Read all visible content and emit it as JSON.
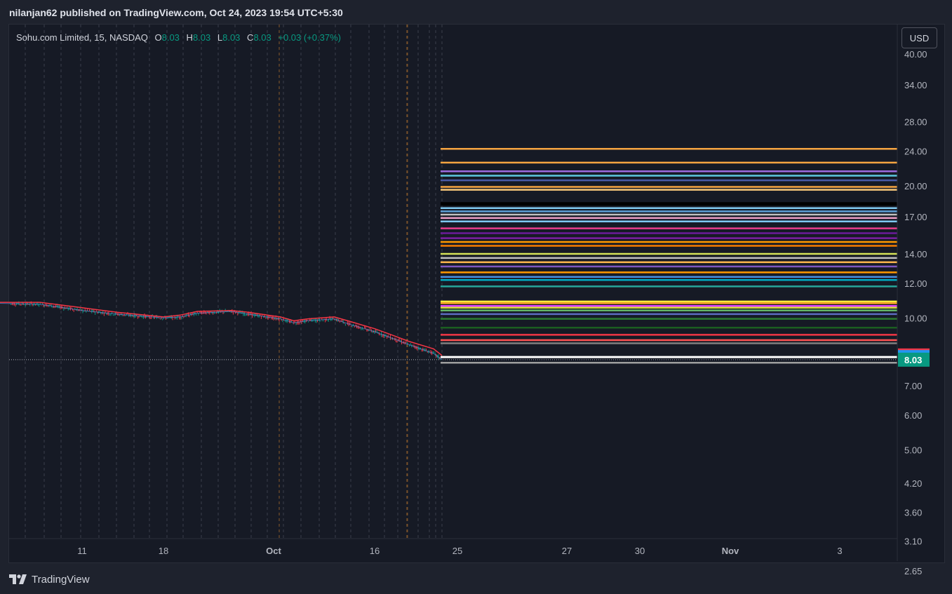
{
  "header": {
    "publish_text": "nilanjan62 published on TradingView.com, Oct 24, 2023 19:54 UTC+5:30"
  },
  "legend": {
    "symbol": "Sohu.com Limited, 15, NASDAQ",
    "open_label": "O",
    "open": "8.03",
    "high_label": "H",
    "high": "8.03",
    "low_label": "L",
    "low": "8.03",
    "close_label": "C",
    "close": "8.03",
    "change": "+0.03 (+0.37%)"
  },
  "currency_button": "USD",
  "footer": {
    "brand": "TradingView",
    "logo_icon": "tradingview-logo-icon"
  },
  "colors": {
    "background": "#161a25",
    "candle_up": "#089981",
    "candle_down": "#f23645",
    "ma_line": "#f23645",
    "price_dotted": "#b2b5be"
  },
  "chart_data": {
    "type": "line",
    "y_scale": "log",
    "ylim": [
      2.6,
      41
    ],
    "y_ticks": [
      "40.00",
      "34.00",
      "28.00",
      "24.00",
      "20.00",
      "17.00",
      "14.00",
      "12.00",
      "10.00",
      "7.00",
      "6.00",
      "5.00",
      "4.20",
      "3.60",
      "3.10",
      "2.65"
    ],
    "x_ticks": [
      "11",
      "18",
      "Oct",
      "16",
      "25",
      "27",
      "30",
      "Nov",
      "3"
    ],
    "series": [
      {
        "name": "",
        "x": [
          "Sep 5",
          "Sep 8",
          "Sep 11",
          "Sep 14",
          "Sep 18",
          "Sep 20",
          "Sep 22",
          "Sep 26",
          "Sep 28",
          "Oct 2",
          "Oct 4",
          "Oct 6",
          "Oct 10",
          "Oct 12",
          "Oct 16",
          "Oct 18",
          "Oct 20",
          "Oct 23",
          "Oct 24"
        ],
        "values": [
          10.8,
          10.75,
          10.4,
          10.2,
          10.0,
          10.05,
          10.25,
          10.35,
          10.2,
          9.95,
          9.75,
          9.85,
          9.95,
          9.7,
          9.3,
          9.0,
          8.7,
          8.3,
          8.03
        ]
      },
      {
        "name": "",
        "x": [
          "Sep 5",
          "Sep 8",
          "Sep 11",
          "Sep 14",
          "Sep 18",
          "Sep 20",
          "Sep 22",
          "Sep 26",
          "Sep 28",
          "Oct 2",
          "Oct 4",
          "Oct 6",
          "Oct 10",
          "Oct 12",
          "Oct 16",
          "Oct 18",
          "Oct 20",
          "Oct 23",
          "Oct 24"
        ],
        "values": [
          10.85,
          10.85,
          10.55,
          10.3,
          10.05,
          10.15,
          10.35,
          10.4,
          10.3,
          10.05,
          9.85,
          9.95,
          10.05,
          9.85,
          9.45,
          9.15,
          8.85,
          8.5,
          8.21
        ]
      }
    ],
    "horizontal_levels": [
      {
        "value": 24.3,
        "color": "#f7a541"
      },
      {
        "value": 22.6,
        "color": "#f7a541"
      },
      {
        "value": 21.6,
        "color": "#9c6ade"
      },
      {
        "value": 21.1,
        "color": "#5ec8e0"
      },
      {
        "value": 20.6,
        "color": "#4a5aa8"
      },
      {
        "value": 19.9,
        "color": "#f7a541"
      },
      {
        "value": 19.6,
        "color": "#f7c77a"
      },
      {
        "value": 18.2,
        "color": "#000000"
      },
      {
        "value": 17.8,
        "color": "#7ec8f0"
      },
      {
        "value": 17.5,
        "color": "#5ea0d8"
      },
      {
        "value": 17.2,
        "color": "#c0c0c0"
      },
      {
        "value": 16.9,
        "color": "#f0a0c8"
      },
      {
        "value": 16.6,
        "color": "#7ec8f0"
      },
      {
        "value": 16.0,
        "color": "#e83e8c"
      },
      {
        "value": 15.6,
        "color": "#6a1b9a"
      },
      {
        "value": 15.2,
        "color": "#7b1fa2"
      },
      {
        "value": 14.9,
        "color": "#ff9800"
      },
      {
        "value": 14.6,
        "color": "#f57c00"
      },
      {
        "value": 14.0,
        "color": "#d4e157"
      },
      {
        "value": 13.7,
        "color": "#c0c0c0"
      },
      {
        "value": 13.4,
        "color": "#ffb74d"
      },
      {
        "value": 13.1,
        "color": "#7e57c2"
      },
      {
        "value": 12.7,
        "color": "#ff9800"
      },
      {
        "value": 12.4,
        "color": "#4a90e2"
      },
      {
        "value": 12.2,
        "color": "#00acc1"
      },
      {
        "value": 11.8,
        "color": "#26a69a"
      },
      {
        "value": 10.9,
        "color": "#ffeb3b"
      },
      {
        "value": 10.8,
        "color": "#ffa726"
      },
      {
        "value": 10.65,
        "color": "#e040fb"
      },
      {
        "value": 10.55,
        "color": "#cddc39"
      },
      {
        "value": 10.4,
        "color": "#66bb6a"
      },
      {
        "value": 10.2,
        "color": "#5c6bc0"
      },
      {
        "value": 9.95,
        "color": "#2e7d32"
      },
      {
        "value": 9.5,
        "color": "#1b5e20"
      },
      {
        "value": 9.15,
        "color": "#f23645"
      },
      {
        "value": 8.9,
        "color": "#ff5252"
      },
      {
        "value": 8.75,
        "color": "#808080"
      },
      {
        "value": 8.14,
        "color": "#ffffff"
      },
      {
        "value": 7.9,
        "color": "#9e9e9e"
      }
    ],
    "price_labels": [
      {
        "value": "8.21",
        "color": "#f23645"
      },
      {
        "value": "8.14",
        "color": "#2196f3"
      },
      {
        "value": "8.03",
        "color": "#089981"
      }
    ],
    "last_price": 8.03
  }
}
